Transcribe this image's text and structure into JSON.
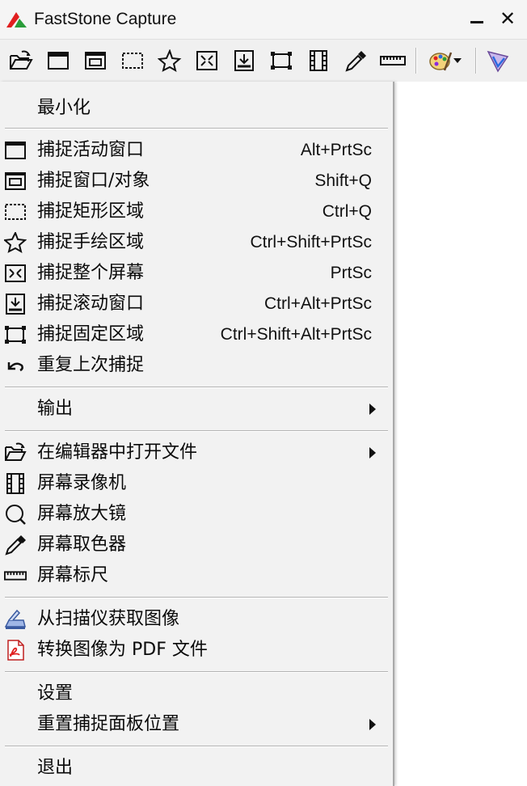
{
  "window": {
    "title": "FastStone Capture",
    "minimize_label": "",
    "close_label": "✕"
  },
  "toolbar": {
    "buttons": [
      {
        "icon": "open-folder-icon"
      },
      {
        "icon": "active-window-icon"
      },
      {
        "icon": "window-object-icon"
      },
      {
        "icon": "rectangle-region-icon"
      },
      {
        "icon": "freehand-region-icon"
      },
      {
        "icon": "full-screen-icon"
      },
      {
        "icon": "scrolling-window-icon"
      },
      {
        "icon": "fixed-region-icon"
      },
      {
        "icon": "screen-recorder-icon"
      },
      {
        "icon": "color-picker-icon"
      },
      {
        "icon": "screen-ruler-icon"
      },
      {
        "icon": "palette-icon"
      },
      {
        "icon": "output-destination-icon"
      }
    ]
  },
  "menu": {
    "minimize": "最小化",
    "capture_active_window": {
      "label": "捕捉活动窗口",
      "shortcut": "Alt+PrtSc"
    },
    "capture_window_object": {
      "label": "捕捉窗口/对象",
      "shortcut": "Shift+Q"
    },
    "capture_rect_region": {
      "label": "捕捉矩形区域",
      "shortcut": "Ctrl+Q"
    },
    "capture_freehand_region": {
      "label": "捕捉手绘区域",
      "shortcut": "Ctrl+Shift+PrtSc"
    },
    "capture_full_screen": {
      "label": "捕捉整个屏幕",
      "shortcut": "PrtSc"
    },
    "capture_scrolling_window": {
      "label": "捕捉滚动窗口",
      "shortcut": "Ctrl+Alt+PrtSc"
    },
    "capture_fixed_region": {
      "label": "捕捉固定区域",
      "shortcut": "Ctrl+Shift+Alt+PrtSc"
    },
    "repeat_last_capture": "重复上次捕捉",
    "output": "输出",
    "open_in_editor": "在编辑器中打开文件",
    "screen_recorder": "屏幕录像机",
    "screen_magnifier": "屏幕放大镜",
    "screen_color_picker": "屏幕取色器",
    "screen_ruler": "屏幕标尺",
    "acquire_from_scanner": "从扫描仪获取图像",
    "convert_to_pdf": "转换图像为 PDF 文件",
    "settings": "设置",
    "reset_panel_position": "重置捕捉面板位置",
    "exit": "退出"
  },
  "colors": {
    "menu_bg": "#f2f2f2",
    "toolbar_bg": "#f0f0f0",
    "accent_red": "#e02020",
    "accent_green": "#2a9d3a"
  }
}
